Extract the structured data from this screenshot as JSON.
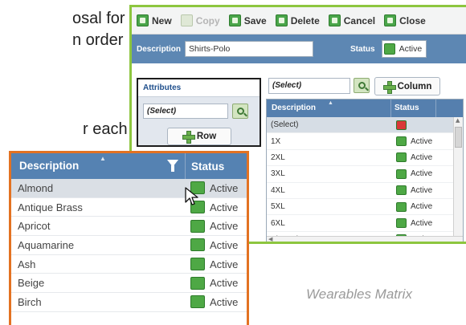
{
  "background_text": {
    "line1": "osal for",
    "line2": "n order",
    "line3": "r each",
    "caption": "Wearables Matrix"
  },
  "toolbar": {
    "buttons": [
      {
        "label": "New",
        "icon": "new-icon",
        "enabled": true
      },
      {
        "label": "Copy",
        "icon": "copy-icon",
        "enabled": false
      },
      {
        "label": "Save",
        "icon": "save-icon",
        "enabled": true
      },
      {
        "label": "Delete",
        "icon": "delete-icon",
        "enabled": true
      },
      {
        "label": "Cancel",
        "icon": "cancel-icon",
        "enabled": true
      },
      {
        "label": "Close",
        "icon": "close-icon",
        "enabled": true
      }
    ]
  },
  "form": {
    "description_label": "Description",
    "description_value": "Shirts-Polo",
    "status_label": "Status",
    "status_value": "Active"
  },
  "attributes": {
    "title": "Attributes",
    "row_select": "(Select)",
    "row_button": "Row",
    "column_select": "(Select)",
    "column_button": "Column"
  },
  "dropdown": {
    "columns": [
      "Description",
      "Status"
    ],
    "rows": [
      {
        "description": "(Select)",
        "status": "",
        "status_color": "#d93838",
        "selected": true
      },
      {
        "description": "1X",
        "status": "Active",
        "status_color": "#4ea845",
        "selected": false
      },
      {
        "description": "2XL",
        "status": "Active",
        "status_color": "#4ea845",
        "selected": false
      },
      {
        "description": "3XL",
        "status": "Active",
        "status_color": "#4ea845",
        "selected": false
      },
      {
        "description": "4XL",
        "status": "Active",
        "status_color": "#4ea845",
        "selected": false
      },
      {
        "description": "5XL",
        "status": "Active",
        "status_color": "#4ea845",
        "selected": false
      },
      {
        "description": "6XL",
        "status": "Active",
        "status_color": "#4ea845",
        "selected": false
      },
      {
        "description": "Almond",
        "status": "Active",
        "status_color": "#4ea845",
        "selected": false
      }
    ]
  },
  "zoom_grid": {
    "columns": [
      "Description",
      "Status"
    ],
    "rows": [
      {
        "description": "Almond",
        "status": "Active",
        "selected": true
      },
      {
        "description": "Antique Brass",
        "status": "Active",
        "selected": false
      },
      {
        "description": "Apricot",
        "status": "Active",
        "selected": false
      },
      {
        "description": "Aquamarine",
        "status": "Active",
        "selected": false
      },
      {
        "description": "Ash",
        "status": "Active",
        "selected": false
      },
      {
        "description": "Beige",
        "status": "Active",
        "selected": false
      },
      {
        "description": "Birch",
        "status": "Active",
        "selected": false
      }
    ]
  },
  "colors": {
    "accent_green": "#8dc63f",
    "header_blue": "#5582b2",
    "zoom_border_orange": "#e37222",
    "status_active": "#4ea845",
    "status_none": "#d93838"
  }
}
